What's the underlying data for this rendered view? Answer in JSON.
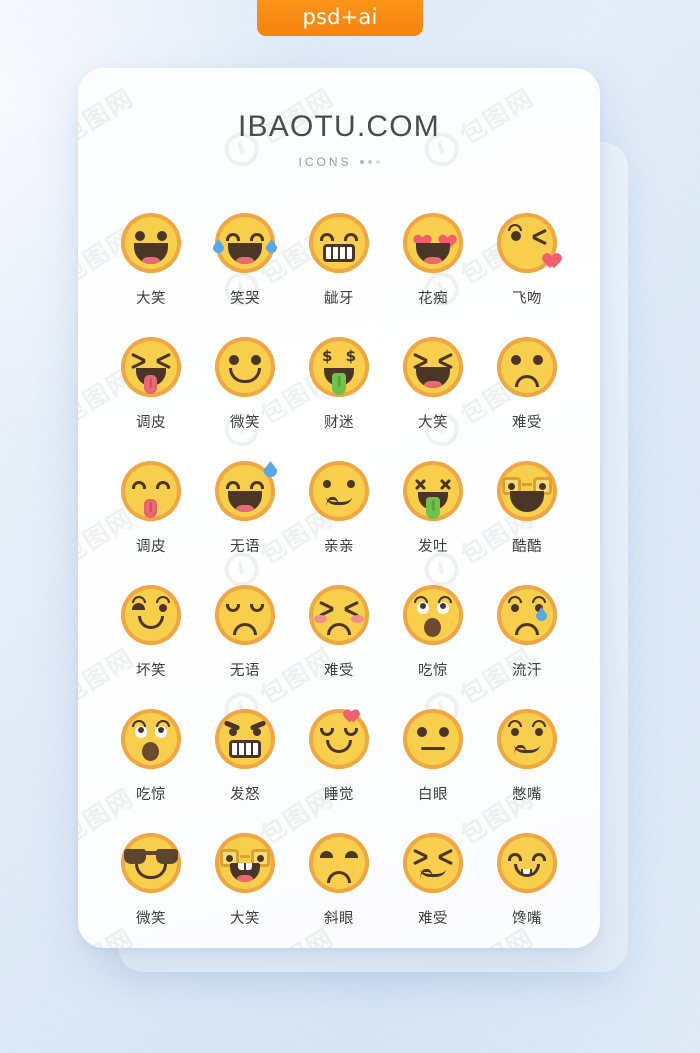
{
  "badge": {
    "label": "psd+ai",
    "color": "#F58410"
  },
  "header": {
    "title": "IBAOTU.COM",
    "subtitle": "ICONS"
  },
  "watermark": {
    "text": "包图网"
  },
  "theme": {
    "face_fill": "#F8CE4D",
    "face_rim": "#EFA644",
    "feature_dark": "#4A3526",
    "tongue_pink": "#EA6A72",
    "tongue_green": "#6FC14B",
    "heart_red": "#F0606C",
    "tear_blue": "#5AA9E6",
    "glasses_gold": "#D9A32E",
    "background": "#dbe7f5",
    "card": "#ffffff"
  },
  "icons": [
    {
      "label": "大笑",
      "name": "grinning-open-mouth"
    },
    {
      "label": "笑哭",
      "name": "laughing-tears"
    },
    {
      "label": "龇牙",
      "name": "grinning-teeth"
    },
    {
      "label": "花痴",
      "name": "heart-eyes"
    },
    {
      "label": "飞吻",
      "name": "blowing-kiss"
    },
    {
      "label": "调皮",
      "name": "playful-tongue-squint"
    },
    {
      "label": "微笑",
      "name": "smiling-face"
    },
    {
      "label": "财迷",
      "name": "money-face"
    },
    {
      "label": "大笑",
      "name": "laughing-squint"
    },
    {
      "label": "难受",
      "name": "sad-frown"
    },
    {
      "label": "调皮",
      "name": "playful-tongue"
    },
    {
      "label": "无语",
      "name": "speechless-sweat"
    },
    {
      "label": "亲亲",
      "name": "kissing-face"
    },
    {
      "label": "发吐",
      "name": "vomiting-face"
    },
    {
      "label": "酷酷",
      "name": "cool-glasses"
    },
    {
      "label": "坏笑",
      "name": "smirking-face"
    },
    {
      "label": "无语",
      "name": "speechless-closed-eyes"
    },
    {
      "label": "难受",
      "name": "distressed-blush"
    },
    {
      "label": "吃惊",
      "name": "surprised-open-mouth"
    },
    {
      "label": "流汗",
      "name": "sweating-tear"
    },
    {
      "label": "吃惊",
      "name": "shocked-raised-brows"
    },
    {
      "label": "发怒",
      "name": "angry-grimace"
    },
    {
      "label": "睡觉",
      "name": "sleeping-heart"
    },
    {
      "label": "白眼",
      "name": "eye-roll-flat"
    },
    {
      "label": "憋嘴",
      "name": "pursed-lips"
    },
    {
      "label": "微笑",
      "name": "sunglasses-smile"
    },
    {
      "label": "大笑",
      "name": "nerd-laughing"
    },
    {
      "label": "斜眼",
      "name": "side-eye-frown"
    },
    {
      "label": "难受",
      "name": "scrunched-face"
    },
    {
      "label": "馋嘴",
      "name": "drooling-smile"
    }
  ]
}
